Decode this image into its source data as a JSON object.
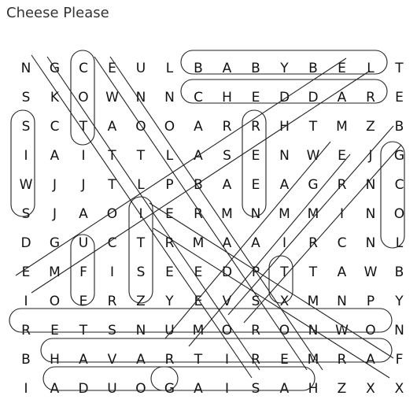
{
  "puzzle": {
    "title": "Cheese Please",
    "rows": [
      [
        "N",
        "G",
        "C",
        "E",
        "U",
        "L",
        "B",
        "A",
        "B",
        "Y",
        "B",
        "E",
        "L",
        "T"
      ],
      [
        "S",
        "K",
        "O",
        "W",
        "N",
        "N",
        "C",
        "H",
        "E",
        "D",
        "D",
        "A",
        "R",
        "E"
      ],
      [
        "S",
        "C",
        "T",
        "A",
        "O",
        "O",
        "A",
        "R",
        "R",
        "H",
        "T",
        "M",
        "Z",
        "B"
      ],
      [
        "I",
        "A",
        "I",
        "T",
        "T",
        "L",
        "A",
        "S",
        "E",
        "N",
        "W",
        "E",
        "J",
        "G"
      ],
      [
        "W",
        "J",
        "J",
        "T",
        "L",
        "P",
        "B",
        "A",
        "E",
        "A",
        "G",
        "R",
        "N",
        "C"
      ],
      [
        "S",
        "J",
        "A",
        "O",
        "I",
        "E",
        "R",
        "M",
        "N",
        "M",
        "M",
        "I",
        "N",
        "O"
      ],
      [
        "D",
        "G",
        "U",
        "C",
        "T",
        "R",
        "M",
        "A",
        "A",
        "I",
        "R",
        "C",
        "N",
        "L"
      ],
      [
        "E",
        "M",
        "F",
        "I",
        "S",
        "E",
        "E",
        "D",
        "P",
        "T",
        "T",
        "A",
        "W",
        "B"
      ],
      [
        "I",
        "O",
        "E",
        "R",
        "Z",
        "Y",
        "E",
        "V",
        "S",
        "X",
        "M",
        "N",
        "P",
        "Y"
      ],
      [
        "R",
        "E",
        "T",
        "S",
        "N",
        "U",
        "M",
        "O",
        "R",
        "O",
        "N",
        "W",
        "O",
        "N"
      ],
      [
        "B",
        "H",
        "A",
        "V",
        "A",
        "R",
        "T",
        "I",
        "R",
        "E",
        "M",
        "R",
        "A",
        "F"
      ],
      [
        "I",
        "A",
        "D",
        "U",
        "O",
        "G",
        "A",
        "I",
        "S",
        "A",
        "H",
        "Z",
        "X",
        "X"
      ]
    ]
  }
}
